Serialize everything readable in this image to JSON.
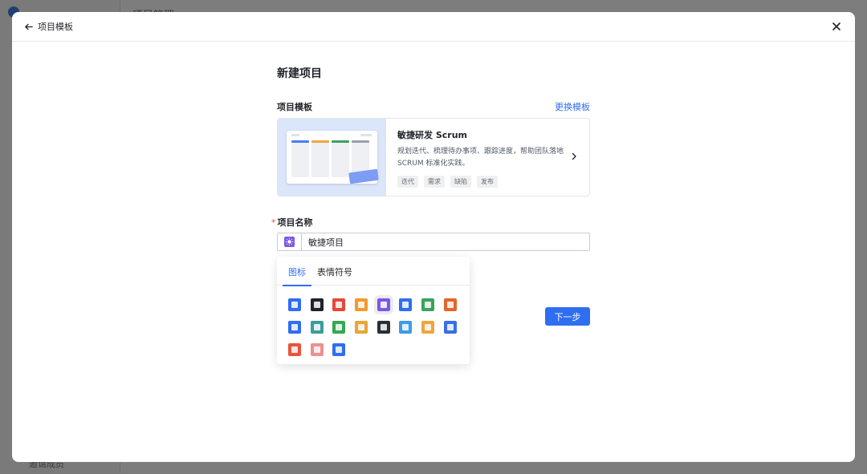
{
  "background": {
    "header_title": "项目管理",
    "footer_text": "邀请成员"
  },
  "modal": {
    "back_label": "项目模板"
  },
  "form": {
    "page_title": "新建项目",
    "template_label": "项目模板",
    "change_template": "更换模板",
    "template": {
      "title": "敏捷研发 Scrum",
      "description": "规划迭代、梳理待办事项、跟踪进度，帮助团队落地 SCRUM 标准化实践。",
      "tags": [
        "迭代",
        "需求",
        "缺陷",
        "发布"
      ]
    },
    "name_label": "项目名称",
    "required_mark": "*",
    "name_value": "敏捷项目",
    "next_button": "下一步"
  },
  "picker": {
    "tabs": [
      "图标",
      "表情符号"
    ],
    "active_tab": 0,
    "icons": [
      {
        "name": "paper-plane-icon",
        "color": "#2f6ef1"
      },
      {
        "name": "ghost-icon",
        "color": "#1f2329"
      },
      {
        "name": "gift-icon",
        "color": "#e5483a"
      },
      {
        "name": "chat-icon",
        "color": "#f29a2e"
      },
      {
        "name": "bulb-icon",
        "color": "#7b57e6",
        "selected": true
      },
      {
        "name": "compass-icon",
        "color": "#2f6ef1"
      },
      {
        "name": "trophy-icon",
        "color": "#3aa35c"
      },
      {
        "name": "ticket-icon",
        "color": "#e2662d"
      },
      {
        "name": "shield-icon",
        "color": "#2f6ef1"
      },
      {
        "name": "map-pin-icon",
        "color": "#3b9d9a"
      },
      {
        "name": "checklist-icon",
        "color": "#35a853"
      },
      {
        "name": "signal-icon",
        "color": "#e9a43a"
      },
      {
        "name": "bar-chart-icon",
        "color": "#2b2f36"
      },
      {
        "name": "billboard-icon",
        "color": "#3f9be6"
      },
      {
        "name": "box-icon",
        "color": "#f0a53f"
      },
      {
        "name": "rocket-icon",
        "color": "#3a6ee8"
      },
      {
        "name": "palette-icon",
        "color": "#e8543a"
      },
      {
        "name": "robot-icon",
        "color": "#ef8f8f"
      },
      {
        "name": "planet-icon",
        "color": "#2f6ef1"
      }
    ]
  }
}
